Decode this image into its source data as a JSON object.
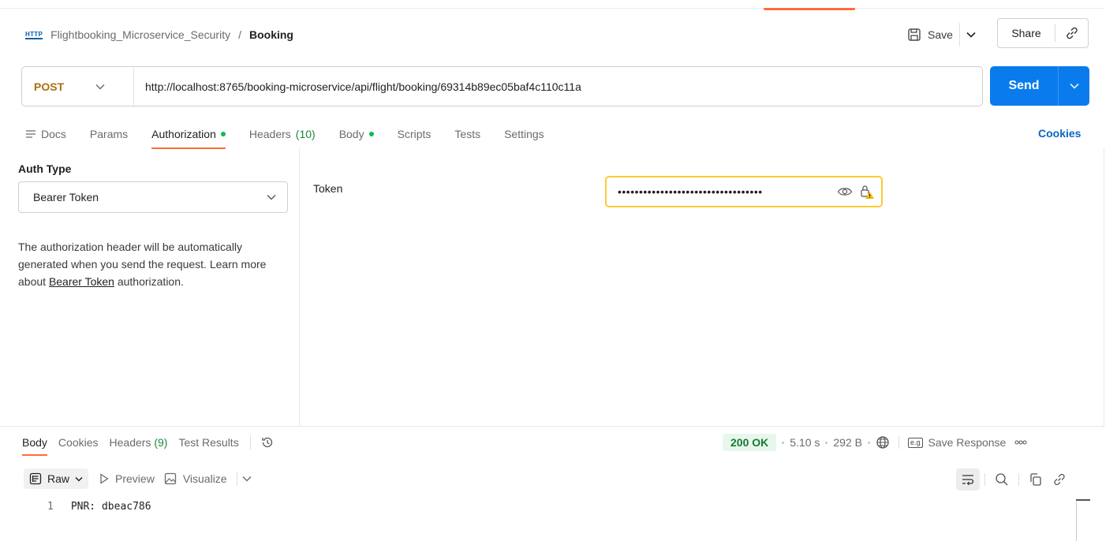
{
  "header": {
    "http_badge": "HTTP",
    "collection": "Flightbooking_Microservice_Security",
    "separator": "/",
    "request_name": "Booking",
    "save_label": "Save",
    "share_label": "Share"
  },
  "request": {
    "method": "POST",
    "url": "http://localhost:8765/booking-microservice/api/flight/booking/69314b89ec05baf4c110c11a",
    "send_label": "Send"
  },
  "tabs": {
    "docs": "Docs",
    "params": "Params",
    "authorization": "Authorization",
    "headers": "Headers",
    "headers_count": "(10)",
    "body": "Body",
    "scripts": "Scripts",
    "tests": "Tests",
    "settings": "Settings",
    "cookies": "Cookies"
  },
  "auth": {
    "type_label": "Auth Type",
    "type_value": "Bearer Token",
    "help_prefix": "The authorization header will be automatically generated when you send the request. Learn more about ",
    "help_link": "Bearer Token",
    "help_suffix": " authorization.",
    "token_label": "Token",
    "token_masked": "••••••••••••••••••••••••••••••••••"
  },
  "response": {
    "tabs": {
      "body": "Body",
      "cookies": "Cookies",
      "headers": "Headers",
      "headers_count": "(9)",
      "test_results": "Test Results"
    },
    "status": "200 OK",
    "time": "5.10 s",
    "size": "292 B",
    "save_response": "Save Response",
    "view": {
      "raw": "Raw",
      "preview": "Preview",
      "visualize": "Visualize"
    },
    "lines": [
      {
        "number": "1",
        "text": "PNR: dbeac786"
      }
    ]
  },
  "colors": {
    "accent": "#ff6c37",
    "send": "#097bed",
    "method_post": "#a9700e",
    "status_ok": "#167a36",
    "token_warning": "#ffc935"
  }
}
